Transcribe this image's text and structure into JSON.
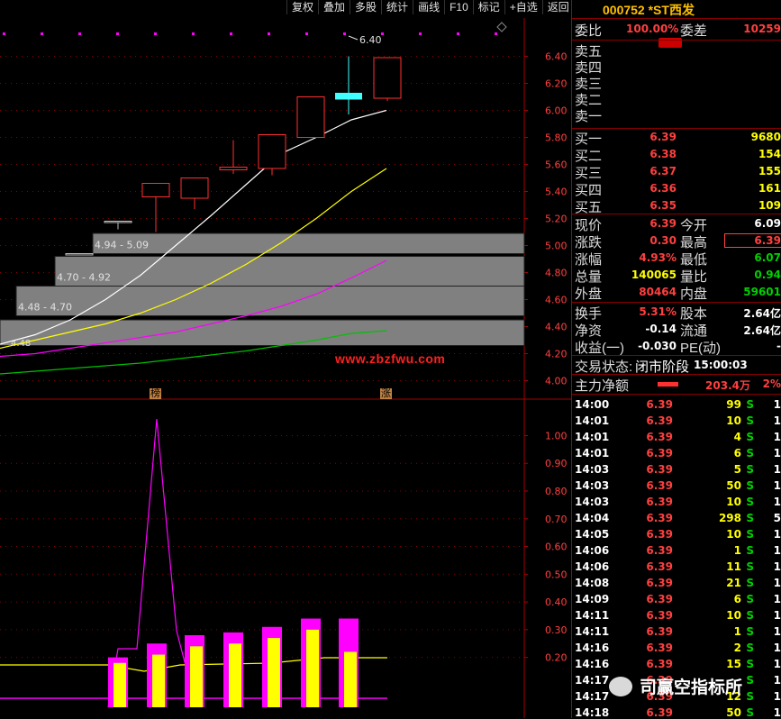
{
  "toolbar": [
    "复权",
    "叠加",
    "多股",
    "统计",
    "画线",
    "F10",
    "标记",
    "+自选",
    "返回"
  ],
  "stock": {
    "code": "000752",
    "name": "*ST西发"
  },
  "commission": {
    "ratio_label": "委比",
    "ratio": "100.00%",
    "diff_label": "委差",
    "diff": "10259"
  },
  "sell_levels": [
    "卖五",
    "卖四",
    "卖三",
    "卖二",
    "卖一"
  ],
  "buy_levels": [
    {
      "label": "买一",
      "price": "6.39",
      "vol": "9680"
    },
    {
      "label": "买二",
      "price": "6.38",
      "vol": "154"
    },
    {
      "label": "买三",
      "price": "6.37",
      "vol": "155"
    },
    {
      "label": "买四",
      "price": "6.36",
      "vol": "161"
    },
    {
      "label": "买五",
      "price": "6.35",
      "vol": "109"
    }
  ],
  "quote": [
    {
      "l1": "现价",
      "v1": "6.39",
      "l2": "今开",
      "v2": "6.09"
    },
    {
      "l1": "涨跌",
      "v1": "0.30",
      "l2": "最高",
      "v2": "6.39"
    },
    {
      "l1": "涨幅",
      "v1": "4.93%",
      "l2": "最低",
      "v2": "6.07"
    },
    {
      "l1": "总量",
      "v1": "140065",
      "l2": "量比",
      "v2": "0.94"
    },
    {
      "l1": "外盘",
      "v1": "80464",
      "l2": "内盘",
      "v2": "59601"
    }
  ],
  "quote2": [
    {
      "l1": "换手",
      "v1": "5.31%",
      "l2": "股本",
      "v2": "2.64亿"
    },
    {
      "l1": "净资",
      "v1": "-0.14",
      "l2": "流通",
      "v2": "2.64亿"
    },
    {
      "l1": "收益(一)",
      "v1": "-0.030",
      "l2": "PE(动)",
      "v2": "-"
    }
  ],
  "trade_status": {
    "label": "交易状态:",
    "value": "闭市阶段",
    "time": "15:00:03"
  },
  "main_net": {
    "label": "主力净额",
    "value": "203.4万",
    "pct": "2%"
  },
  "ticks": [
    {
      "t": "14:00",
      "p": "6.39",
      "v": "99",
      "s": "S",
      "n": "1"
    },
    {
      "t": "14:01",
      "p": "6.39",
      "v": "10",
      "s": "S",
      "n": "1"
    },
    {
      "t": "14:01",
      "p": "6.39",
      "v": "4",
      "s": "S",
      "n": "1"
    },
    {
      "t": "14:01",
      "p": "6.39",
      "v": "6",
      "s": "S",
      "n": "1"
    },
    {
      "t": "14:03",
      "p": "6.39",
      "v": "5",
      "s": "S",
      "n": "1"
    },
    {
      "t": "14:03",
      "p": "6.39",
      "v": "50",
      "s": "S",
      "n": "1"
    },
    {
      "t": "14:03",
      "p": "6.39",
      "v": "10",
      "s": "S",
      "n": "1"
    },
    {
      "t": "14:04",
      "p": "6.39",
      "v": "298",
      "s": "S",
      "n": "5"
    },
    {
      "t": "14:05",
      "p": "6.39",
      "v": "10",
      "s": "S",
      "n": "1"
    },
    {
      "t": "14:06",
      "p": "6.39",
      "v": "1",
      "s": "S",
      "n": "1"
    },
    {
      "t": "14:06",
      "p": "6.39",
      "v": "11",
      "s": "S",
      "n": "1"
    },
    {
      "t": "14:08",
      "p": "6.39",
      "v": "21",
      "s": "S",
      "n": "1"
    },
    {
      "t": "14:09",
      "p": "6.39",
      "v": "6",
      "s": "S",
      "n": "1"
    },
    {
      "t": "14:11",
      "p": "6.39",
      "v": "10",
      "s": "S",
      "n": "1"
    },
    {
      "t": "14:11",
      "p": "6.39",
      "v": "1",
      "s": "S",
      "n": "1"
    },
    {
      "t": "14:16",
      "p": "6.39",
      "v": "2",
      "s": "S",
      "n": "1"
    },
    {
      "t": "14:16",
      "p": "6.39",
      "v": "15",
      "s": "S",
      "n": "1"
    },
    {
      "t": "14:17",
      "p": "6.39",
      "v": "",
      "s": "S",
      "n": "1"
    },
    {
      "t": "14:17",
      "p": "6.39",
      "v": "12",
      "s": "S",
      "n": "1"
    },
    {
      "t": "14:18",
      "p": "6.39",
      "v": "50",
      "s": "S",
      "n": "1"
    }
  ],
  "watermark": "www.zbzfwu.com",
  "wechat_text": "司赢空指标所",
  "tags": [
    "榜",
    "涨"
  ],
  "chart_data": [
    {
      "type": "candlestick",
      "ylim": [
        3.95,
        6.45
      ],
      "y_ticks": [
        "6.40",
        "6.20",
        "6.00",
        "5.80",
        "5.60",
        "5.40",
        "5.20",
        "5.00",
        "4.80",
        "4.60",
        "4.40",
        "4.20",
        "4.00"
      ],
      "max_label": "6.40",
      "candles": [
        {
          "o": 4.94,
          "h": 4.94,
          "l": 4.94,
          "c": 4.94,
          "color": "#c0c0c0"
        },
        {
          "o": 5.18,
          "h": 5.18,
          "l": 5.12,
          "c": 5.18,
          "color": "#c0c0c0"
        },
        {
          "o": 5.36,
          "h": 5.46,
          "l": 5.1,
          "c": 5.46,
          "color": "#ff3030"
        },
        {
          "o": 5.35,
          "h": 5.5,
          "l": 5.27,
          "c": 5.5,
          "color": "#ff3030"
        },
        {
          "o": 5.56,
          "h": 5.78,
          "l": 5.53,
          "c": 5.58,
          "color": "#ff3030"
        },
        {
          "o": 5.57,
          "h": 5.82,
          "l": 5.52,
          "c": 5.82,
          "color": "#ff3030"
        },
        {
          "o": 5.8,
          "h": 6.1,
          "l": 5.8,
          "c": 6.1,
          "color": "#ff3030"
        },
        {
          "o": 6.13,
          "h": 6.4,
          "l": 5.97,
          "c": 6.08,
          "color": "#40ffff"
        },
        {
          "o": 6.09,
          "h": 6.39,
          "l": 6.07,
          "c": 6.39,
          "color": "#ff3030"
        }
      ],
      "boxes": [
        {
          "low": 4.26,
          "high": 4.45,
          "start": 0
        },
        {
          "low": 4.48,
          "high": 4.7,
          "label": "4.48 - 4.70",
          "start": 0
        },
        {
          "low": 4.7,
          "high": 4.92,
          "label": "4.70 - 4.92",
          "start": 1
        },
        {
          "low": 4.94,
          "high": 5.09,
          "label": "4.94 - 5.09",
          "start": 2
        }
      ],
      "box_end_label": "4.48",
      "ma_white": [
        4.27,
        4.34,
        4.45,
        4.6,
        4.78,
        5.0,
        5.22,
        5.45,
        5.68,
        5.8,
        5.93,
        6.0
      ],
      "ma_yellow": [
        4.24,
        4.3,
        4.36,
        4.42,
        4.5,
        4.6,
        4.72,
        4.86,
        5.02,
        5.2,
        5.4,
        5.57
      ],
      "ma_magenta": [
        4.18,
        4.2,
        4.24,
        4.28,
        4.32,
        4.36,
        4.42,
        4.48,
        4.55,
        4.64,
        4.76,
        4.89
      ],
      "ma_green": [
        4.05,
        4.07,
        4.09,
        4.11,
        4.13,
        4.16,
        4.19,
        4.22,
        4.26,
        4.3,
        4.35,
        4.37
      ]
    },
    {
      "type": "line",
      "ylim": [
        0.02,
        1.06
      ],
      "y_ticks": [
        "1.00",
        "0.90",
        "0.80",
        "0.70",
        "0.60",
        "0.50",
        "0.40",
        "0.30",
        "0.20"
      ],
      "magenta_line": [
        0.0,
        0.0,
        0.18,
        1.0,
        0.2,
        0.0,
        0.0,
        0.0,
        0.0,
        0.0,
        0.0
      ],
      "yellow_bars": [
        0.18,
        0.21,
        0.24,
        0.25,
        0.27,
        0.3,
        0.3
      ],
      "magenta_bar_tops": [
        0.2,
        0.25,
        0.28,
        0.29,
        0.31,
        0.34,
        0.34
      ],
      "baseline": 0.17
    }
  ]
}
